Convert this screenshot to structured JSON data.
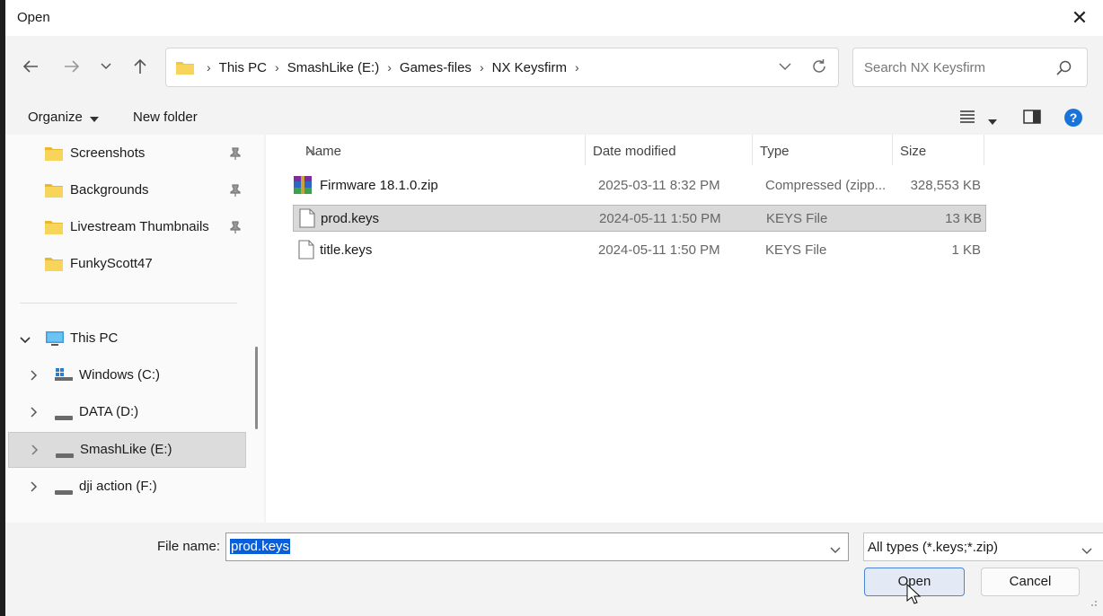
{
  "window": {
    "title": "Open"
  },
  "address": {
    "crumbs": [
      "This PC",
      "SmashLike (E:)",
      "Games-files",
      "NX Keysfirm"
    ]
  },
  "search": {
    "placeholder": "Search NX Keysfirm"
  },
  "toolbar": {
    "organize_label": "Organize",
    "new_folder_label": "New folder"
  },
  "sidebar": {
    "quick_access": [
      {
        "label": "Screenshots",
        "pinned": true
      },
      {
        "label": "Backgrounds",
        "pinned": true
      },
      {
        "label": "Livestream Thumbnails",
        "pinned": true
      },
      {
        "label": "FunkyScott47",
        "pinned": false
      }
    ],
    "this_pc_label": "This PC",
    "drives": [
      {
        "label": "Windows (C:)",
        "icon": "windows-drive-icon"
      },
      {
        "label": "DATA (D:)",
        "icon": "drive-icon"
      },
      {
        "label": "SmashLike (E:)",
        "icon": "drive-icon",
        "selected": true
      },
      {
        "label": "dji action (F:)",
        "icon": "drive-icon"
      }
    ]
  },
  "columns": {
    "name": "Name",
    "date": "Date modified",
    "type": "Type",
    "size": "Size"
  },
  "files": [
    {
      "name": "Firmware 18.1.0.zip",
      "date": "2025-03-11 8:32 PM",
      "type": "Compressed (zipp...",
      "size": "328,553 KB",
      "icon": "zip-archive-icon"
    },
    {
      "name": "prod.keys",
      "date": "2024-05-11 1:50 PM",
      "type": "KEYS File",
      "size": "13 KB",
      "icon": "file-icon",
      "selected": true
    },
    {
      "name": "title.keys",
      "date": "2024-05-11 1:50 PM",
      "type": "KEYS File",
      "size": "1 KB",
      "icon": "file-icon"
    }
  ],
  "bottom": {
    "file_name_label": "File name:",
    "file_name_value": "prod.keys",
    "file_type_value": "All types (*.keys;*.zip)",
    "open_label": "Open",
    "cancel_label": "Cancel"
  },
  "colors": {
    "selection_blue": "#0a5fd8",
    "folder_yellow": "#f2c744",
    "help_blue": "#1a73d9"
  }
}
